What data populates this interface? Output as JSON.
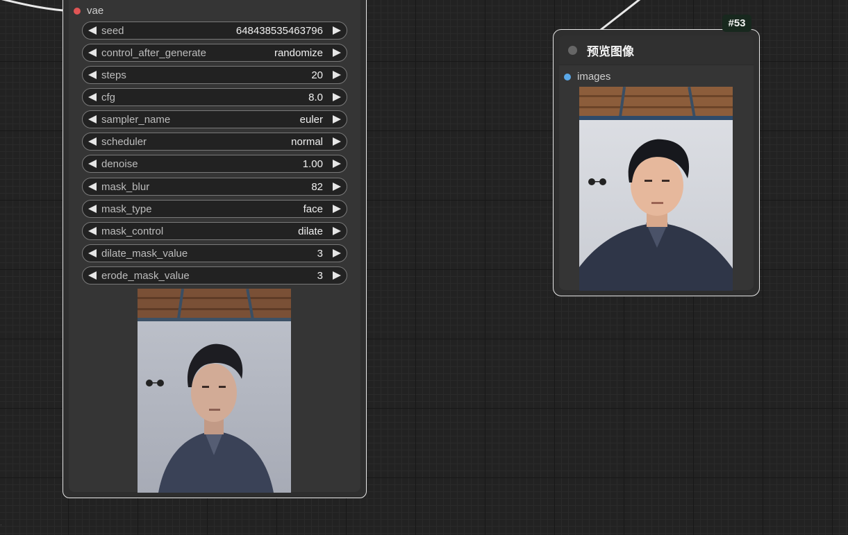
{
  "left_node": {
    "input": {
      "label": "vae",
      "color": "#e05555"
    },
    "widgets": [
      {
        "label": "seed",
        "value": "648438535463796"
      },
      {
        "label": "control_after_generate",
        "value": "randomize"
      },
      {
        "label": "steps",
        "value": "20"
      },
      {
        "label": "cfg",
        "value": "8.0"
      },
      {
        "label": "sampler_name",
        "value": "euler"
      },
      {
        "label": "scheduler",
        "value": "normal"
      },
      {
        "label": "denoise",
        "value": "1.00"
      },
      {
        "label": "mask_blur",
        "value": "82"
      },
      {
        "label": "mask_type",
        "value": "face"
      },
      {
        "label": "mask_control",
        "value": "dilate"
      },
      {
        "label": "dilate_mask_value",
        "value": "3"
      },
      {
        "label": "erode_mask_value",
        "value": "3"
      }
    ]
  },
  "right_node": {
    "id_badge": "#53",
    "title": "预览图像",
    "input": {
      "label": "images",
      "color": "#5aa8e8"
    }
  },
  "colors": {
    "canvas_bg": "#222222",
    "node_bg": "#353535",
    "widget_bg": "#222222",
    "node_outline": "#e8e8e8",
    "badge_bg": "#18281e"
  },
  "icons": {
    "widget_decrement": "triangle-left-icon",
    "widget_increment": "triangle-right-icon",
    "node_status": "circle-dot-icon"
  }
}
